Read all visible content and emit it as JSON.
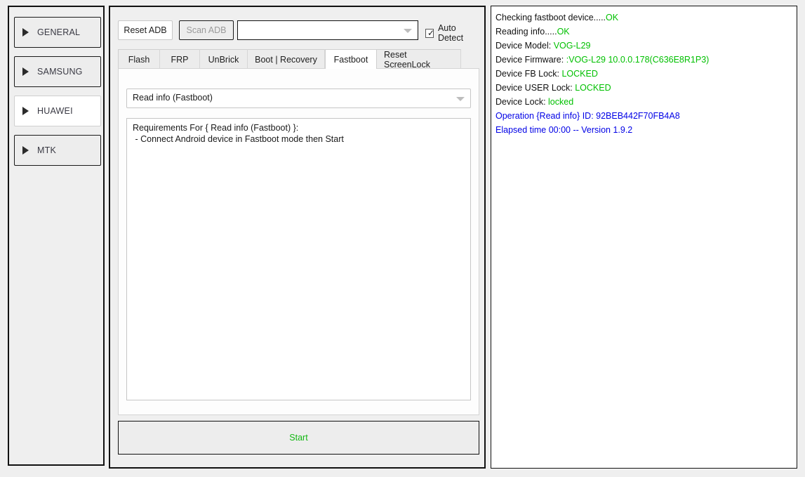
{
  "sidebar": {
    "items": [
      {
        "label": "GENERAL",
        "icon": "triangle-right-icon",
        "selected": false
      },
      {
        "label": "SAMSUNG",
        "icon": "triangle-right-icon",
        "selected": false
      },
      {
        "label": "HUAWEI",
        "icon": "triangle-right-icon",
        "selected": true
      },
      {
        "label": "MTK",
        "icon": "triangle-right-icon",
        "selected": false
      }
    ]
  },
  "toolbar": {
    "reset_adb_label": "Reset ADB",
    "scan_adb_label": "Scan ADB",
    "scan_adb_disabled": true,
    "device_combo_value": "",
    "device_combo_placeholder": "",
    "auto_detect_label": "Auto Detect",
    "auto_detect_checked": true,
    "auto_detect_tick": "✓"
  },
  "tabs": [
    {
      "label": "Flash",
      "active": false
    },
    {
      "label": "FRP",
      "active": false
    },
    {
      "label": "UnBrick",
      "active": false
    },
    {
      "label": "Boot | Recovery",
      "active": false
    },
    {
      "label": "Fastboot",
      "active": true
    },
    {
      "label": "Reset ScreenLock",
      "active": false
    }
  ],
  "panel": {
    "operation_selected": "Read info (Fastboot)",
    "requirements_text": "Requirements For { Read info (Fastboot) }:\n - Connect Android device in Fastboot mode then Start",
    "start_label": "Start",
    "start_color": "#14b814"
  },
  "log": {
    "colors": {
      "label": "#111111",
      "ok": "#00c000",
      "info": "#0000e6"
    },
    "lines": [
      [
        {
          "t": "Checking fastboot device.....",
          "c": "label"
        },
        {
          "t": "OK",
          "c": "ok"
        }
      ],
      [
        {
          "t": "Reading info.....",
          "c": "label"
        },
        {
          "t": "OK",
          "c": "ok"
        }
      ],
      [
        {
          "t": "Device Model: ",
          "c": "label"
        },
        {
          "t": "VOG-L29",
          "c": "ok"
        }
      ],
      [
        {
          "t": "Device Firmware: ",
          "c": "label"
        },
        {
          "t": ":VOG-L29 10.0.0.178(C636E8R1P3)",
          "c": "ok"
        }
      ],
      [
        {
          "t": "Device FB Lock: ",
          "c": "label"
        },
        {
          "t": "LOCKED",
          "c": "ok"
        }
      ],
      [
        {
          "t": "Device USER Lock: ",
          "c": "label"
        },
        {
          "t": "LOCKED",
          "c": "ok"
        }
      ],
      [
        {
          "t": "Device Lock: ",
          "c": "label"
        },
        {
          "t": "locked",
          "c": "ok"
        }
      ],
      [
        {
          "t": "Operation {Read info} ID: 92BEB442F70FB4A8",
          "c": "info"
        }
      ],
      [
        {
          "t": "Elapsed time 00:00 -- Version 1.9.2",
          "c": "info"
        }
      ]
    ]
  }
}
